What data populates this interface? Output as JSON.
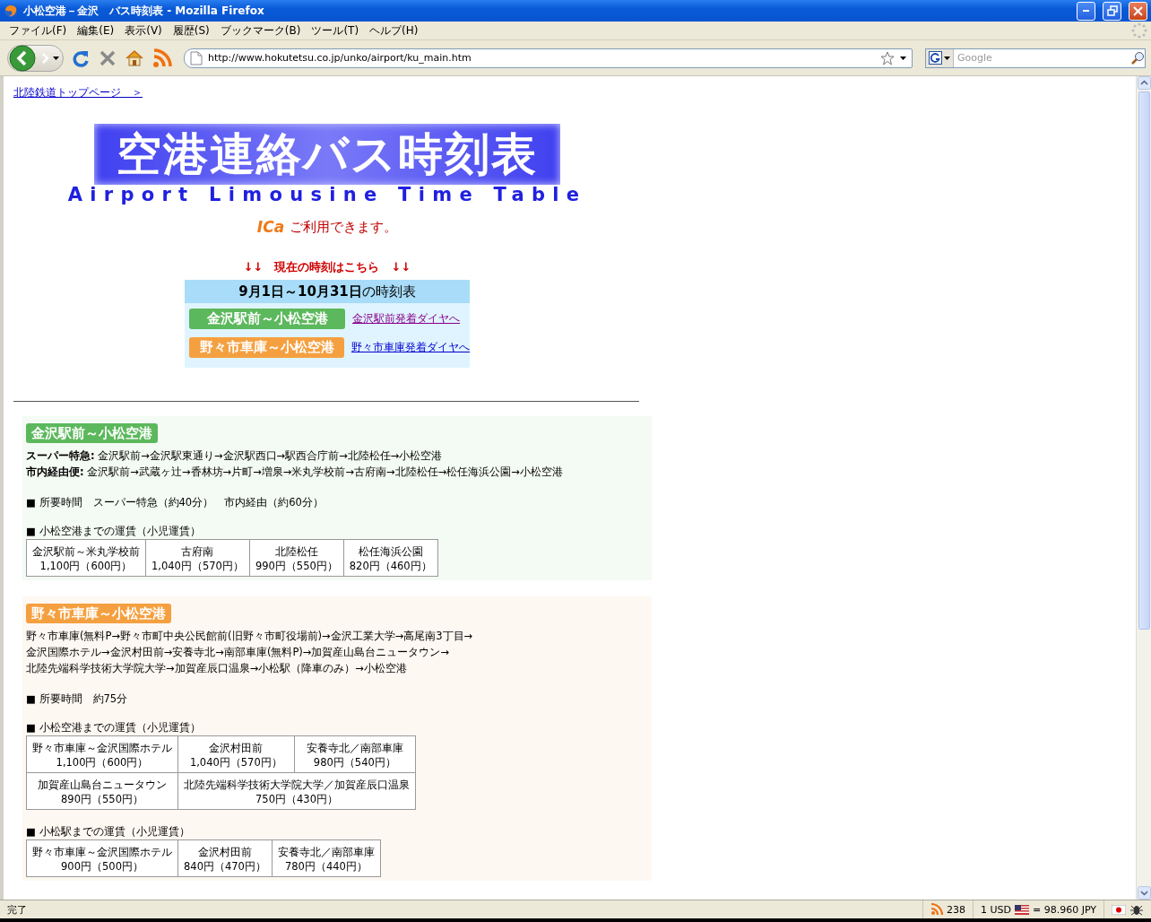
{
  "window": {
    "title": "小松空港－金沢　バス時刻表 - Mozilla Firefox"
  },
  "menu": [
    "ファイル(F)",
    "編集(E)",
    "表示(V)",
    "履歴(S)",
    "ブックマーク(B)",
    "ツール(T)",
    "ヘルプ(H)"
  ],
  "toolbar": {
    "url": "http://www.hokutetsu.co.jp/unko/airport/ku_main.htm",
    "search_placeholder": "Google"
  },
  "page": {
    "top_link": "北陸鉄道トップページ　＞",
    "banner_title": "空港連絡バス時刻表",
    "banner_subtitle": "Airport Limousine Time Table",
    "ica_logo": "ICa",
    "ica_text": "ご利用できます。",
    "notice": "↓↓　現在の時刻はこちら　↓↓",
    "period": "**9月1日～10月31日**の時刻表",
    "routes_nav": [
      {
        "badge": "金沢駅前～小松空港",
        "color": "#5cb85c",
        "link": "金沢駅前発着ダイヤへ",
        "visited": true
      },
      {
        "badge": "野々市車庫～小松空港",
        "color": "#f5a040",
        "link": "野々市車庫発着ダイヤへ",
        "visited": false
      }
    ]
  },
  "sections": [
    {
      "badge": "金沢駅前～小松空港",
      "color": "#5cb85c",
      "route_lines": [
        "**スーパー特急:** 金沢駅前→金沢駅東通り→金沢駅西口→駅西合庁前→北陸松任→小松空港",
        "**市内経由便:** 金沢駅前→武蔵ヶ辻→香林坊→片町→増泉→米丸学校前→古府南→北陸松任→松任海浜公園→小松空港"
      ],
      "duration": "■ 所要時間　スーパー特急（約40分）　市内経由（約60分）",
      "fare_tables": [
        {
          "title": "■ 小松空港までの運賃（小児運賃）",
          "rows": [
            [
              {
                "name": "金沢駅前～米丸学校前",
                "fare": "1,100円（600円）"
              },
              {
                "name": "古府南",
                "fare": "1,040円（570円）"
              },
              {
                "name": "北陸松任",
                "fare": "990円（550円）"
              },
              {
                "name": "松任海浜公園",
                "fare": "820円（460円）"
              }
            ]
          ]
        }
      ]
    },
    {
      "badge": "野々市車庫～小松空港",
      "color": "#f5a040",
      "route_lines": [
        "野々市車庫(無料P→野々市町中央公民館前(旧野々市町役場前)→金沢工業大学→高尾南3丁目→",
        "金沢国際ホテル→金沢村田前→安養寺北→南部車庫(無料P)→加賀産山島台ニュータウン→",
        "北陸先端科学技術大学院大学→加賀産辰口温泉→小松駅（降車のみ）→小松空港"
      ],
      "duration": "■ 所要時間　約75分",
      "fare_tables": [
        {
          "title": "■ 小松空港までの運賃（小児運賃）",
          "rows": [
            [
              {
                "name": "野々市車庫～金沢国際ホテル",
                "fare": "1,100円（600円）"
              },
              {
                "name": "金沢村田前",
                "fare": "1,040円（570円）"
              },
              {
                "name": "安養寺北／南部車庫",
                "fare": "980円（540円）"
              }
            ],
            [
              {
                "name": "加賀産山島台ニュータウン",
                "fare": "890円（550円）"
              },
              {
                "name": "北陸先端科学技術大学院大学／加賀産辰口温泉",
                "fare": "750円（430円）",
                "colspan": 2
              }
            ]
          ]
        },
        {
          "title": "■ 小松駅までの運賃（小児運賃）",
          "rows": [
            [
              {
                "name": "野々市車庫～金沢国際ホテル",
                "fare": "900円（500円）"
              },
              {
                "name": "金沢村田前",
                "fare": "840円（470円）"
              },
              {
                "name": "安養寺北／南部車庫",
                "fare": "780円（440円）"
              }
            ]
          ]
        }
      ]
    }
  ],
  "status_bar": {
    "text": "完了",
    "feed_count": "238",
    "currency_from": "1 USD",
    "currency_to": "= 98.960 JPY"
  }
}
